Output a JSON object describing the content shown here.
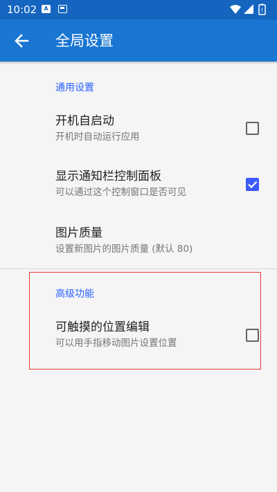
{
  "status_bar": {
    "time": "10:02",
    "notif_a": "A"
  },
  "app_bar": {
    "title": "全局设置"
  },
  "sections": [
    {
      "header": "通用设置",
      "items": [
        {
          "title": "开机自启动",
          "summary": "开机时自动运行应用",
          "checked": false
        },
        {
          "title": "显示通知栏控制面板",
          "summary": "可以通过这个控制窗口是否可见",
          "checked": true
        },
        {
          "title": "图片质量",
          "summary": "设置新图片的图片质量 (默认 80)"
        }
      ]
    },
    {
      "header": "高级功能",
      "items": [
        {
          "title": "可触摸的位置编辑",
          "summary": "可以用手指移动图片设置位置",
          "checked": false
        }
      ]
    }
  ],
  "colors": {
    "status_bar": "#1565c0",
    "app_bar": "#1976d2",
    "accent": "#3d5afe",
    "section_header": "#2962ff",
    "highlight": "#e53935"
  }
}
